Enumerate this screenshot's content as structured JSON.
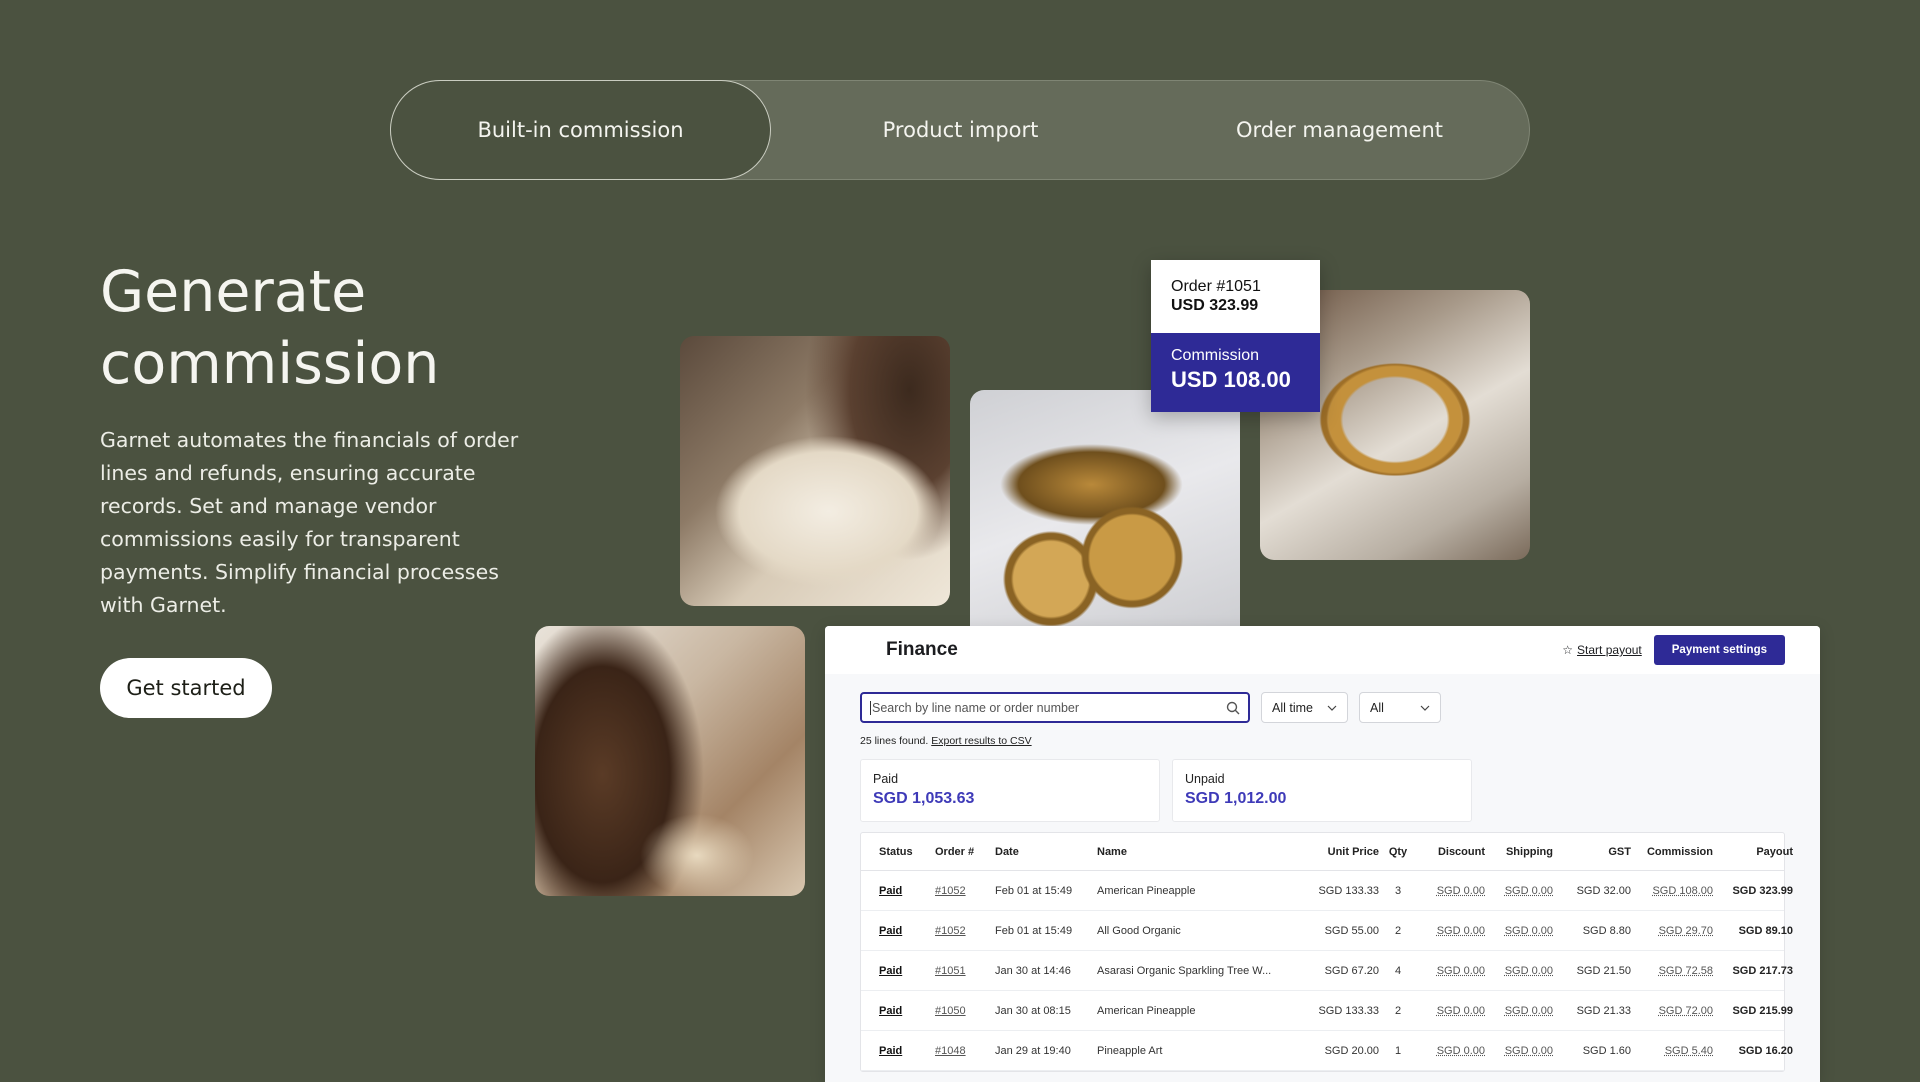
{
  "tabs": [
    {
      "label": "Built-in commission",
      "active": true
    },
    {
      "label": "Product import",
      "active": false
    },
    {
      "label": "Order management",
      "active": false
    }
  ],
  "hero": {
    "title": "Generate commission",
    "body": "Garnet automates the financials of order lines and refunds, ensuring accurate records. Set and manage vendor commissions easily for transparent payments. Simplify financial processes with Garnet.",
    "cta": "Get started"
  },
  "order_popup": {
    "order_label": "Order #1051",
    "order_total": "USD 323.99",
    "commission_label": "Commission",
    "commission_value": "USD 108.00"
  },
  "finance": {
    "title": "Finance",
    "start_payout": "Start payout",
    "payment_settings": "Payment settings",
    "search_placeholder": "Search by line name or order number",
    "time_filter": "All time",
    "status_filter": "All",
    "found_text": "25 lines found.",
    "export_link": "Export results to CSV",
    "paid_label": "Paid",
    "paid_value": "SGD 1,053.63",
    "unpaid_label": "Unpaid",
    "unpaid_value": "SGD 1,012.00",
    "columns": [
      "Status",
      "Order #",
      "Date",
      "Name",
      "Unit Price",
      "Qty",
      "Discount",
      "Shipping",
      "GST",
      "Commission",
      "Payout"
    ],
    "rows": [
      {
        "status": "Paid",
        "order": "#1052",
        "date": "Feb 01 at 15:49",
        "name": "American Pineapple",
        "unit_price": "SGD 133.33",
        "qty": "3",
        "discount": "SGD 0.00",
        "shipping": "SGD 0.00",
        "gst": "SGD 32.00",
        "commission": "SGD 108.00",
        "payout": "SGD 323.99"
      },
      {
        "status": "Paid",
        "order": "#1052",
        "date": "Feb 01 at 15:49",
        "name": "All Good Organic",
        "unit_price": "SGD 55.00",
        "qty": "2",
        "discount": "SGD 0.00",
        "shipping": "SGD 0.00",
        "gst": "SGD 8.80",
        "commission": "SGD 29.70",
        "payout": "SGD 89.10"
      },
      {
        "status": "Paid",
        "order": "#1051",
        "date": "Jan 30 at 14:46",
        "name": "Asarasi Organic Sparkling Tree W...",
        "unit_price": "SGD 67.20",
        "qty": "4",
        "discount": "SGD 0.00",
        "shipping": "SGD 0.00",
        "gst": "SGD 21.50",
        "commission": "SGD 72.58",
        "payout": "SGD 217.73"
      },
      {
        "status": "Paid",
        "order": "#1050",
        "date": "Jan 30 at 08:15",
        "name": "American Pineapple",
        "unit_price": "SGD 133.33",
        "qty": "2",
        "discount": "SGD 0.00",
        "shipping": "SGD 0.00",
        "gst": "SGD 21.33",
        "commission": "SGD 72.00",
        "payout": "SGD 215.99"
      },
      {
        "status": "Paid",
        "order": "#1048",
        "date": "Jan 29 at 19:40",
        "name": "Pineapple Art",
        "unit_price": "SGD 20.00",
        "qty": "1",
        "discount": "SGD 0.00",
        "shipping": "SGD 0.00",
        "gst": "SGD 1.60",
        "commission": "SGD 5.40",
        "payout": "SGD 16.20"
      }
    ]
  },
  "colors": {
    "background": "#4b5240",
    "accent": "#2e2a96",
    "stat_value": "#3e3ab8"
  },
  "icons": {
    "search": "search-icon",
    "star": "star-icon",
    "chevron": "chevron-down-icon"
  }
}
